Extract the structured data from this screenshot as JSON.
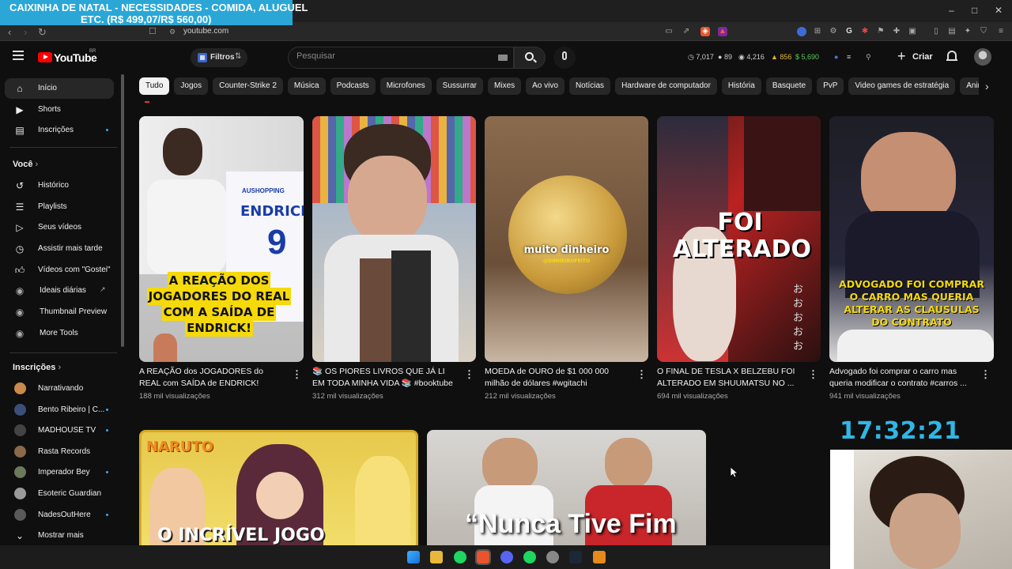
{
  "overlay": {
    "banner_line1": "CAIXINHA DE NATAL - NECESSIDADES - COMIDA, ALUGUEL",
    "banner_line2": "ETC. (R$ 499,07/R$ 560,00)",
    "clock": "17:32:21"
  },
  "browser": {
    "url": "youtube.com",
    "win_controls": [
      "–",
      "□",
      "✕"
    ]
  },
  "masthead": {
    "logo_text": "YouTube",
    "country_code": "BR",
    "filters_label": "Filtros",
    "search_placeholder": "Pesquisar",
    "create_label": "Criar",
    "stats": [
      "7,017",
      "89",
      "4,216",
      "856",
      "5,690"
    ]
  },
  "sidebar": {
    "main": [
      {
        "label": "Início",
        "icon": "home-icon"
      },
      {
        "label": "Shorts",
        "icon": "shorts-icon"
      },
      {
        "label": "Inscrições",
        "icon": "subscriptions-icon"
      }
    ],
    "you_heading": "Você",
    "you_items": [
      {
        "label": "Histórico",
        "icon": "history-icon"
      },
      {
        "label": "Playlists",
        "icon": "playlists-icon"
      },
      {
        "label": "Seus vídeos",
        "icon": "your-videos-icon"
      },
      {
        "label": "Assistir mais tarde",
        "icon": "watch-later-icon"
      },
      {
        "label": "Vídeos com \"Gostei\"",
        "icon": "like-icon"
      },
      {
        "label": "Ideais diárias",
        "icon": "ideas-icon"
      },
      {
        "label": "Thumbnail Preview",
        "icon": "thumbnail-preview-icon"
      },
      {
        "label": "More Tools",
        "icon": "tools-icon"
      }
    ],
    "subs_heading": "Inscrições",
    "subs": [
      {
        "label": "Narrativando",
        "color": "#c98a4a"
      },
      {
        "label": "Bento Ribeiro | C...",
        "color": "#3b4f7a"
      },
      {
        "label": "MADHOUSE TV",
        "color": "#444444"
      },
      {
        "label": "Rasta Records",
        "color": "#8a6a4a"
      },
      {
        "label": "Imperador Bey",
        "color": "#6a7a5a"
      },
      {
        "label": "Esoteric Guardian",
        "color": "#9a9a9a"
      },
      {
        "label": "NadesOutHere",
        "color": "#5a5a5a"
      }
    ],
    "show_more": "Mostrar mais"
  },
  "chips": [
    "Tudo",
    "Jogos",
    "Counter-Strike 2",
    "Música",
    "Podcasts",
    "Microfones",
    "Sussurrar",
    "Mixes",
    "Ao vivo",
    "Notícias",
    "Hardware de computador",
    "História",
    "Basquete",
    "PvP",
    "Video games de estratégia",
    "Animê"
  ],
  "videos": [
    {
      "title": "A REAÇÃO dos JOGADORES do REAL com SAÍDA de ENDRICK! #endrick ...",
      "views": "188 mil visualizações",
      "caption": "A REAÇÃO DOS JOGADORES DO REAL COM A SAÍDA DE ENDRICK!",
      "jersey": "ENDRICK",
      "sponsor": "AUSHOPPING"
    },
    {
      "title": "📚 OS PIORES LIVROS QUE JÁ LI EM TODA MINHA VIDA 📚 #booktube ...",
      "views": "312 mil visualizações"
    },
    {
      "title": "MOEDA de OURO de $1 000 000 milhão de dólares #wgitachi",
      "views": "212 mil visualizações",
      "caption": "muito dinheiro",
      "subcaption": "@DINHEIROFEITO"
    },
    {
      "title": "O FINAL DE TESLA X BELZEBU FOI ALTERADO EM SHUUMATSU NO ...",
      "views": "694 mil visualizações",
      "caption": "FOI ALTERADO"
    },
    {
      "title": "Advogado foi comprar o carro mas queria modificar o contrato #carros ...",
      "views": "941 mil visualizações",
      "caption": "ADVOGADO FOI COMPRAR O CARRO MAS QUERIA ALTERAR AS CLAUSULAS DO CONTRATO"
    },
    {
      "caption": "NARUTO",
      "subcaption": "O INCRÍVEL JOGO"
    },
    {
      "caption": "“Nunca Tive Fim"
    }
  ]
}
